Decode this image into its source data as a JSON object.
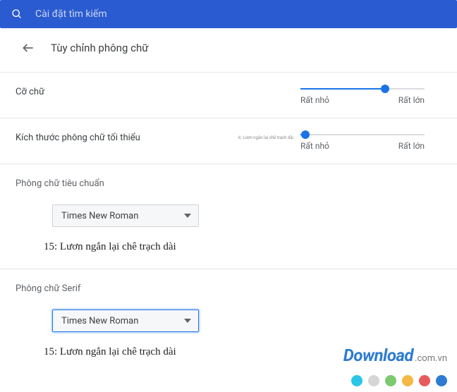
{
  "topbar": {
    "search_placeholder": "Cài đặt tìm kiếm"
  },
  "header": {
    "title": "Tùy chỉnh phông chữ"
  },
  "font_size": {
    "label": "Cỡ chữ",
    "min_label": "Rất nhỏ",
    "max_label": "Rất lớn",
    "value_pct": 68
  },
  "min_font_size": {
    "label": "Kích thước phông chữ tối thiểu",
    "min_label": "Rất nhỏ",
    "max_label": "Rất lớn",
    "value_pct": 4,
    "tiny_preview": "6: Lươn ngắn lại chê trạch dài"
  },
  "standard_font": {
    "label": "Phông chữ tiêu chuẩn",
    "selected": "Times New Roman",
    "preview": "15: Lươn ngắn lại chê trạch dài"
  },
  "serif_font": {
    "label": "Phông chữ Serif",
    "selected": "Times New Roman",
    "preview": "15: Lươn ngắn lại chê trạch dài"
  },
  "watermark": {
    "brand": "Download",
    "domain": ".com.vn"
  },
  "dots": [
    "#2bc5e8",
    "#d6d6d6",
    "#7cc96f",
    "#f4b843",
    "#e85b5b",
    "#2d7cd1"
  ]
}
